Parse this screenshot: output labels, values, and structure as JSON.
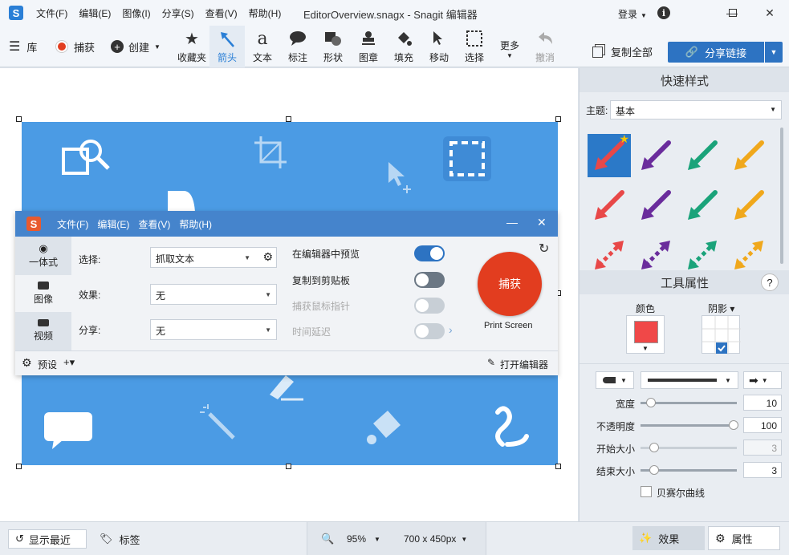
{
  "window": {
    "title": "EditorOverview.snagx - Snagit 编辑器",
    "logo_letter": "S",
    "menu": [
      "文件(F)",
      "编辑(E)",
      "图像(I)",
      "分享(S)",
      "查看(V)",
      "帮助(H)"
    ],
    "login": "登录",
    "info": "i"
  },
  "toolbar": {
    "library": "库",
    "capture": "捕获",
    "create": "创建",
    "tools": [
      {
        "label": "收藏夹",
        "icon": "star-icon"
      },
      {
        "label": "箭头",
        "icon": "arrow-icon"
      },
      {
        "label": "文本",
        "icon": "text-icon"
      },
      {
        "label": "标注",
        "icon": "callout-icon"
      },
      {
        "label": "形状",
        "icon": "shape-icon"
      },
      {
        "label": "图章",
        "icon": "stamp-icon"
      },
      {
        "label": "填充",
        "icon": "fill-icon"
      },
      {
        "label": "移动",
        "icon": "move-icon"
      },
      {
        "label": "选择",
        "icon": "selection-icon"
      },
      {
        "label": "更多",
        "icon": "chevron-down-icon"
      },
      {
        "label": "撤消",
        "icon": "undo-icon"
      }
    ],
    "copy_all": "复制全部",
    "share_link": "分享链接"
  },
  "capture_window": {
    "logo_letter": "S",
    "menu": [
      "文件(F)",
      "编辑(E)",
      "查看(V)",
      "帮助(H)"
    ],
    "tabs": [
      {
        "label": "一体式",
        "icon": "all-in-one-icon"
      },
      {
        "label": "图像",
        "icon": "camera-icon"
      },
      {
        "label": "视频",
        "icon": "video-icon"
      }
    ],
    "fields": [
      {
        "label": "选择:",
        "value": "抓取文本"
      },
      {
        "label": "效果:",
        "value": "无"
      },
      {
        "label": "分享:",
        "value": "无"
      }
    ],
    "options": [
      {
        "label": "在编辑器中预览",
        "on": true,
        "enabled": true
      },
      {
        "label": "复制到剪贴板",
        "on": false,
        "enabled": true
      },
      {
        "label": "捕获鼠标指针",
        "on": false,
        "enabled": false
      },
      {
        "label": "时间延迟",
        "on": false,
        "enabled": false
      }
    ],
    "capture_button": "捕获",
    "hotkey": "Print Screen",
    "presets": "预设",
    "open_editor": "打开编辑器"
  },
  "quick_styles": {
    "header": "快速样式",
    "theme_label": "主题:",
    "theme_value": "基本",
    "colors": [
      "#e84848",
      "#6a2c9c",
      "#1aa37a",
      "#f0a81c"
    ]
  },
  "tool_properties": {
    "header": "工具属性",
    "help": "?",
    "color_label": "颜色",
    "color_value": "#f04848",
    "shadow_label": "阴影",
    "sliders": [
      {
        "label": "宽度",
        "value": "10",
        "fraction": 0.06,
        "enabled": true
      },
      {
        "label": "不透明度",
        "value": "100",
        "fraction": 1.0,
        "enabled": true
      },
      {
        "label": "开始大小",
        "value": "3",
        "fraction": 0.1,
        "enabled": false
      },
      {
        "label": "结束大小",
        "value": "3",
        "fraction": 0.1,
        "enabled": true
      }
    ],
    "bezier_label": "贝赛尔曲线"
  },
  "statusbar": {
    "show_recent": "显示最近",
    "tags": "标签",
    "zoom": "95%",
    "size": "700 x 450px",
    "effects": "效果",
    "properties": "属性"
  }
}
